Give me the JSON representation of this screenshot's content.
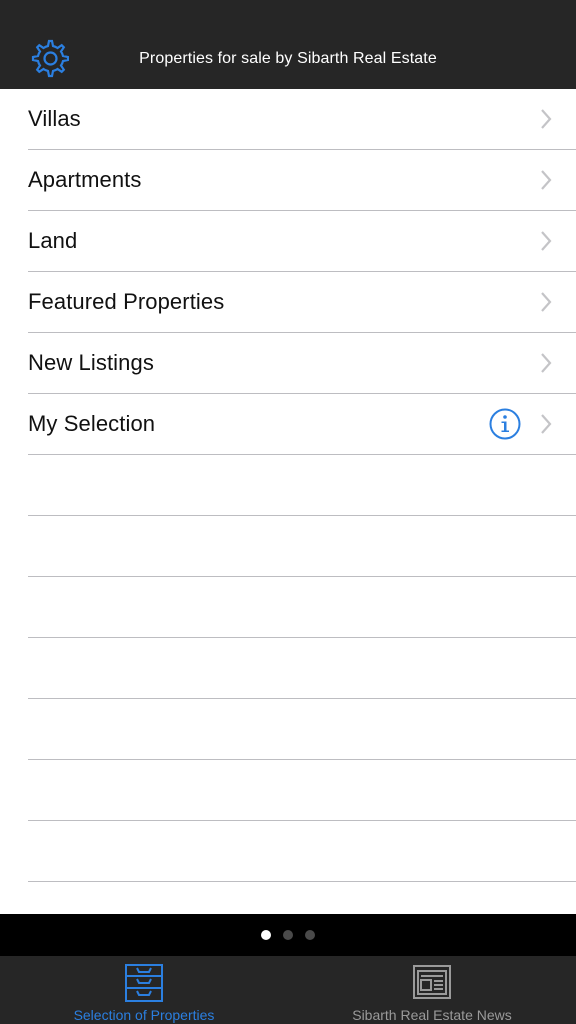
{
  "header": {
    "title": "Properties for sale by Sibarth Real Estate",
    "settings_icon": "gear-icon"
  },
  "menu": {
    "items": [
      {
        "label": "Villas"
      },
      {
        "label": "Apartments"
      },
      {
        "label": "Land"
      },
      {
        "label": "Featured Properties"
      },
      {
        "label": "New Listings"
      },
      {
        "label": "My Selection"
      }
    ]
  },
  "page_indicator": {
    "pages": 3,
    "current": 1
  },
  "tabs": [
    {
      "label": "Selection of Properties",
      "icon": "drawer-icon",
      "active": true
    },
    {
      "label": "Sibarth Real Estate News",
      "icon": "newspaper-icon",
      "active": false
    }
  ],
  "colors": {
    "accent": "#2b7fe0",
    "bar_background": "#262626",
    "inactive_tab": "#9a9a9a",
    "separator": "#bdbdc1",
    "chevron": "#c4c4c7"
  }
}
